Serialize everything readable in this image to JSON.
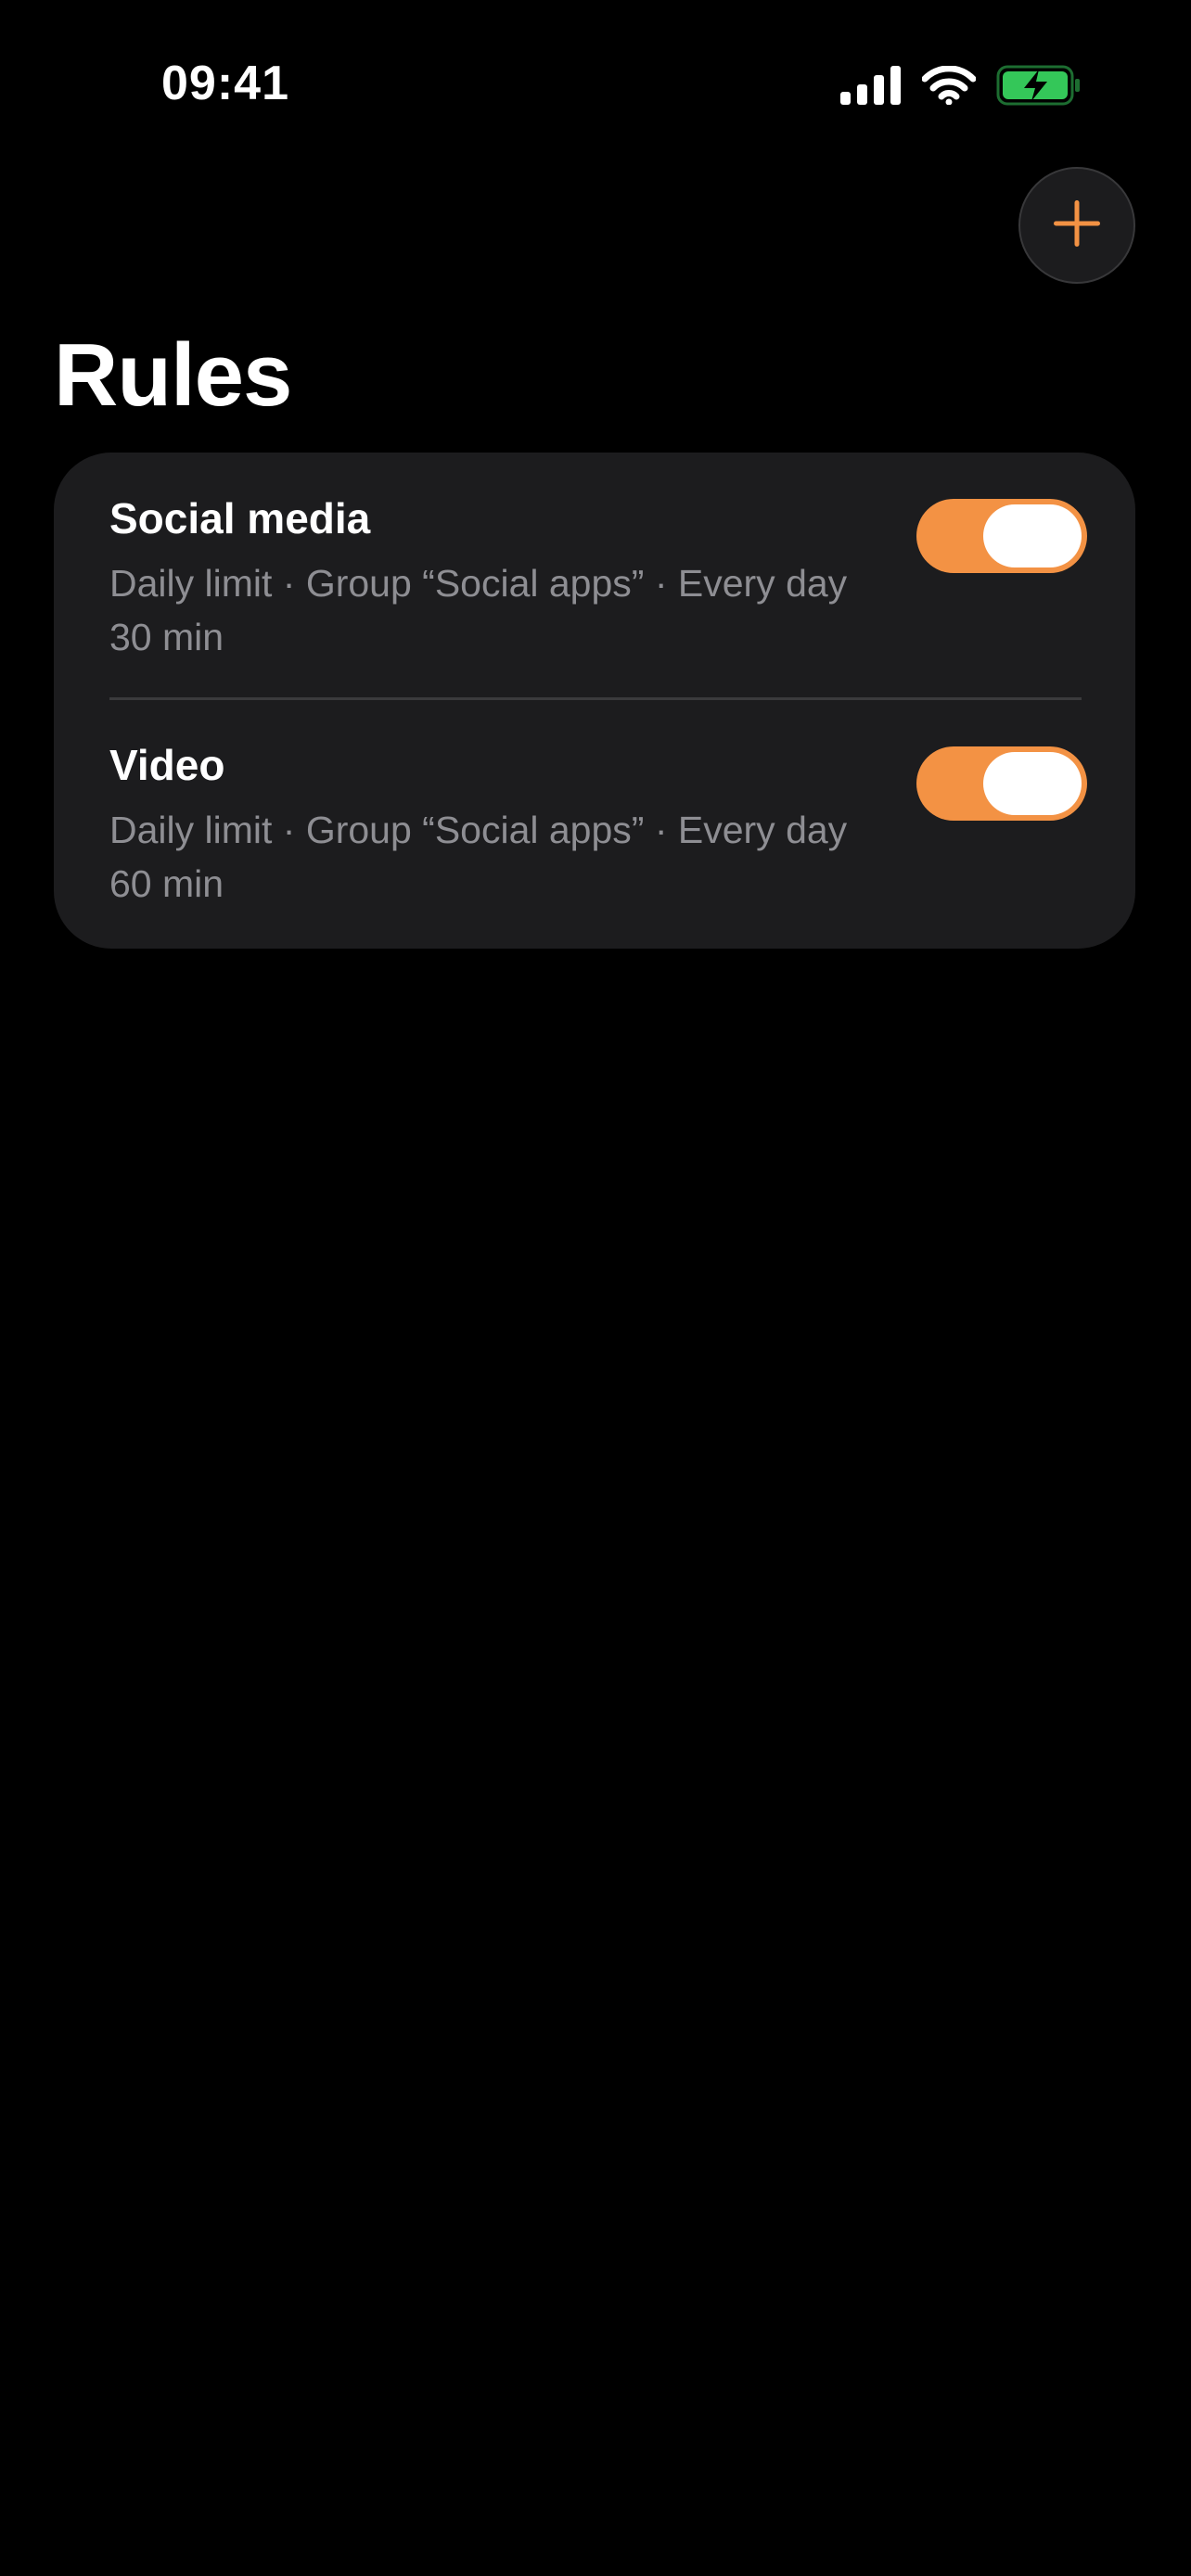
{
  "status_bar": {
    "time": "09:41",
    "icons": [
      "cellular-signal-icon",
      "wifi-icon",
      "battery-charging-icon"
    ],
    "battery_color": "#34c759"
  },
  "header": {
    "add_button_icon": "plus-icon",
    "title": "Rules"
  },
  "rules": [
    {
      "title": "Social media",
      "description": "Daily limit · Group “Social apps” · Every day 30 min",
      "enabled": true
    },
    {
      "title": "Video",
      "description": "Daily limit · Group “Social apps” · Every day 60 min",
      "enabled": true
    }
  ],
  "colors": {
    "accent": "#f39244",
    "background": "#000000",
    "card": "#1c1c1e",
    "secondary_text": "#8e8e93"
  }
}
